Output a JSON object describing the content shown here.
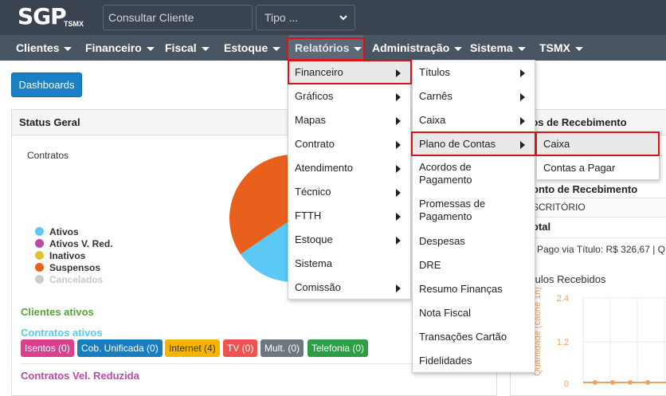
{
  "header": {
    "logo_main": "SGP",
    "logo_sub": "TSMX",
    "search_placeholder": "Consultar Cliente",
    "tipo_label": "Tipo ..."
  },
  "nav": {
    "items": [
      {
        "label": "Clientes"
      },
      {
        "label": "Financeiro"
      },
      {
        "label": "Fiscal"
      },
      {
        "label": "Estoque"
      },
      {
        "label": "Relatórios"
      },
      {
        "label": "Administração"
      },
      {
        "label": "Sistema"
      },
      {
        "label": "TSMX"
      }
    ]
  },
  "dashboards_button": "Dashboards",
  "status_panel": {
    "title": "Status Geral",
    "contracts_label": "Contratos",
    "legend": [
      {
        "label": "Ativos",
        "color": "#5bc8f5"
      },
      {
        "label": "Ativos V. Red.",
        "color": "#b94aa5"
      },
      {
        "label": "Inativos",
        "color": "#e0c23a"
      },
      {
        "label": "Suspensos",
        "color": "#e8601c"
      },
      {
        "label": "Cancelados",
        "color": "#cccccc"
      }
    ],
    "clientes_ativos": "Clientes ativos",
    "contratos_ativos": "Contratos ativos",
    "badges": [
      {
        "label": "Isentos (0)",
        "color": "#d9418f"
      },
      {
        "label": "Cob. Unificada (0)",
        "color": "#1a7dbf"
      },
      {
        "label": "Internet (4)",
        "color": "#f4b400"
      },
      {
        "label": "TV (0)",
        "color": "#ef5350"
      },
      {
        "label": "Mult. (0)",
        "color": "#6d7780"
      },
      {
        "label": "Telefonia (0)",
        "color": "#2e9e44"
      }
    ],
    "contratos_vel_reduzida": "Contratos Vel. Reduzida"
  },
  "right_panel": {
    "title_partial": "tos de Recebimento",
    "row1": "onto de Recebimento",
    "row2": "SCRITÓRIO",
    "row3": "otal",
    "paid_text": "l Pago via Título: R$ 326,67 | Q",
    "chart_title": "tulos Recebidos",
    "chart_data": {
      "type": "line",
      "ylabel": "Quantidade (cache 1h)",
      "yticks": [
        "2.4",
        "1.2",
        "0"
      ],
      "series": [
        {
          "values": [
            0,
            0,
            0,
            0
          ]
        }
      ]
    }
  },
  "menus": {
    "relatorios": [
      {
        "label": "Financeiro",
        "arrow": true
      },
      {
        "label": "Gráficos",
        "arrow": true
      },
      {
        "label": "Mapas",
        "arrow": true
      },
      {
        "label": "Contrato",
        "arrow": true
      },
      {
        "label": "Atendimento",
        "arrow": true
      },
      {
        "label": "Técnico",
        "arrow": true
      },
      {
        "label": "FTTH",
        "arrow": true
      },
      {
        "label": "Estoque",
        "arrow": true
      },
      {
        "label": "Sistema",
        "arrow": false
      },
      {
        "label": "Comissão",
        "arrow": true
      }
    ],
    "financeiro": [
      {
        "label": "Títulos",
        "arrow": true
      },
      {
        "label": "Carnês",
        "arrow": true
      },
      {
        "label": "Caixa",
        "arrow": true
      },
      {
        "label": "Plano de Contas",
        "arrow": true
      },
      {
        "label": "Acordos de Pagamento",
        "arrow": false
      },
      {
        "label": "Promessas de Pagamento",
        "arrow": false
      },
      {
        "label": "Despesas",
        "arrow": false
      },
      {
        "label": "DRE",
        "arrow": false
      },
      {
        "label": "Resumo Finanças",
        "arrow": false
      },
      {
        "label": "Nota Fiscal",
        "arrow": false
      },
      {
        "label": "Transações Cartão",
        "arrow": false
      },
      {
        "label": "Fidelidades",
        "arrow": false
      }
    ],
    "plano_de_contas": [
      {
        "label": "Caixa"
      },
      {
        "label": "Contas a Pagar"
      }
    ]
  },
  "pie": {
    "slices": [
      {
        "label": "Ativos",
        "value": 67,
        "color": "#5bc8f5"
      },
      {
        "label": "Suspensos",
        "value": 33,
        "color": "#e8601c"
      }
    ]
  }
}
